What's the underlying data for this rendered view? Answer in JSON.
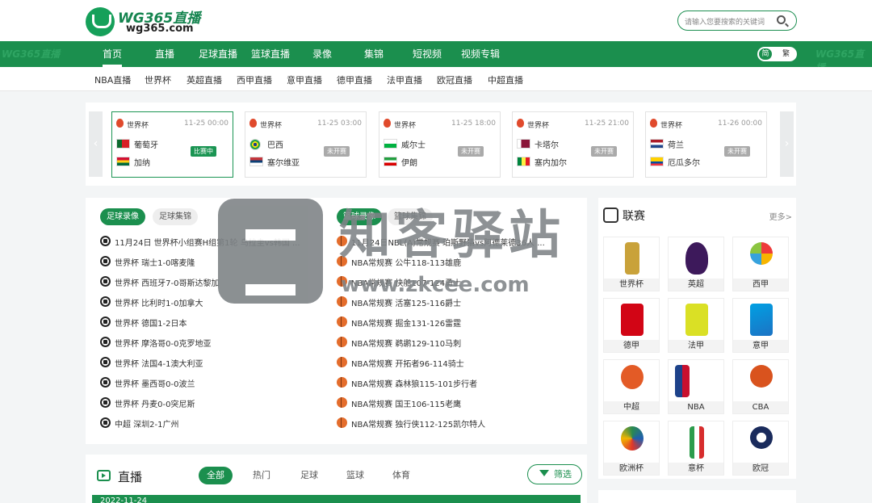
{
  "brand": {
    "name": "WG365直播",
    "domain": "wg365.com"
  },
  "search": {
    "placeholder": "请输入您要搜索的关键词"
  },
  "nav": [
    {
      "label": "首页"
    },
    {
      "label": "直播"
    },
    {
      "label": "足球直播"
    },
    {
      "label": "篮球直播"
    },
    {
      "label": "录像"
    },
    {
      "label": "集锦"
    },
    {
      "label": "短视频"
    },
    {
      "label": "视频专辑"
    }
  ],
  "lang": {
    "simplified": "简",
    "traditional": "繁"
  },
  "subnav": [
    "NBA直播",
    "世界杯",
    "英超直播",
    "西甲直播",
    "意甲直播",
    "德甲直播",
    "法甲直播",
    "欧冠直播",
    "中超直播"
  ],
  "matches": [
    {
      "league": "世界杯",
      "time": "11-25 00:00",
      "home": "葡萄牙",
      "away": "加纳",
      "status": "比赛中",
      "live": true,
      "home_colors": [
        "#0b6b2e",
        "#d71f26"
      ],
      "away_colors": [
        "#d21034",
        "#fcd116",
        "#006b3f"
      ]
    },
    {
      "league": "世界杯",
      "time": "11-25 03:00",
      "home": "巴西",
      "away": "塞尔维亚",
      "status": "未开赛",
      "live": false,
      "home_colors": [
        "#229e45",
        "#f8e509"
      ],
      "away_colors": [
        "#c6363c",
        "#0c4076",
        "#ffffff"
      ]
    },
    {
      "league": "世界杯",
      "time": "11-25 18:00",
      "home": "威尔士",
      "away": "伊朗",
      "status": "未开赛",
      "live": false,
      "home_colors": [
        "#ffffff",
        "#00b140"
      ],
      "away_colors": [
        "#239f40",
        "#ffffff",
        "#da0000"
      ]
    },
    {
      "league": "世界杯",
      "time": "11-25 21:00",
      "home": "卡塔尔",
      "away": "塞内加尔",
      "status": "未开赛",
      "live": false,
      "home_colors": [
        "#8a1538",
        "#ffffff"
      ],
      "away_colors": [
        "#00853f",
        "#fdef42",
        "#e31b23"
      ]
    },
    {
      "league": "世界杯",
      "time": "11-26 00:00",
      "home": "荷兰",
      "away": "厄瓜多尔",
      "status": "未开赛",
      "live": false,
      "home_colors": [
        "#ae1c28",
        "#ffffff",
        "#21468b"
      ],
      "away_colors": [
        "#ffd100",
        "#034ea2",
        "#ef3340"
      ]
    }
  ],
  "football_tabs": [
    "足球录像",
    "足球集锦"
  ],
  "basketball_tabs": [
    "篮球录像",
    "篮球集锦"
  ],
  "football_list": [
    "11月24日 世界杯小组赛H组第1轮 乌拉圭vs韩国 ...",
    "世界杯 瑞士1-0喀麦隆",
    "世界杯 西班牙7-0哥斯达黎加",
    "世界杯 比利时1-0加拿大",
    "世界杯 德国1-2日本",
    "世界杯 摩洛哥0-0克罗地亚",
    "世界杯 法国4-1澳大利亚",
    "世界杯 墨西哥0-0波兰",
    "世界杯 丹麦0-0突尼斯",
    "中超 深圳2-1广州"
  ],
  "basketball_list": [
    "11月24日NBL(A)常规赛 珀斯野猫vs阿德莱德36人 ...",
    "NBA常规赛 公牛118-113雄鹿",
    "NBA常规赛 快船107-124勇士",
    "NBA常规赛 活塞125-116爵士",
    "NBA常规赛 掘金131-126雷霆",
    "NBA常规赛 鹈鹕129-110马刺",
    "NBA常规赛 开拓者96-114骑士",
    "NBA常规赛 森林狼115-101步行者",
    "NBA常规赛 国王106-115老鹰",
    "NBA常规赛 独行侠112-125凯尔特人"
  ],
  "leagues_panel": {
    "title": "联赛",
    "more": "更多>"
  },
  "leagues": [
    {
      "name": "世界杯",
      "color": "#c9a23a"
    },
    {
      "name": "英超",
      "color": "#3d195b"
    },
    {
      "name": "西甲",
      "color": "#ee3b3b"
    },
    {
      "name": "德甲",
      "color": "#d20515"
    },
    {
      "name": "法甲",
      "color": "#dae025"
    },
    {
      "name": "意甲",
      "color": "#1c73c4"
    },
    {
      "name": "中超",
      "color": "#e35b26"
    },
    {
      "name": "NBA",
      "color": "#1d428a"
    },
    {
      "name": "CBA",
      "color": "#d9531e"
    },
    {
      "name": "欧洲杯",
      "color": "#2a8a4f"
    },
    {
      "name": "意杯",
      "color": "#2c9c4c"
    },
    {
      "name": "欧冠",
      "color": "#1a2b5c"
    }
  ],
  "live": {
    "title": "直播",
    "tabs": [
      "全部",
      "热门",
      "足球",
      "篮球",
      "体育"
    ],
    "filter": "筛选",
    "date": "2022-11-24"
  },
  "watermark": {
    "brand": "知客驿站",
    "url": "www.zkcee.com"
  }
}
